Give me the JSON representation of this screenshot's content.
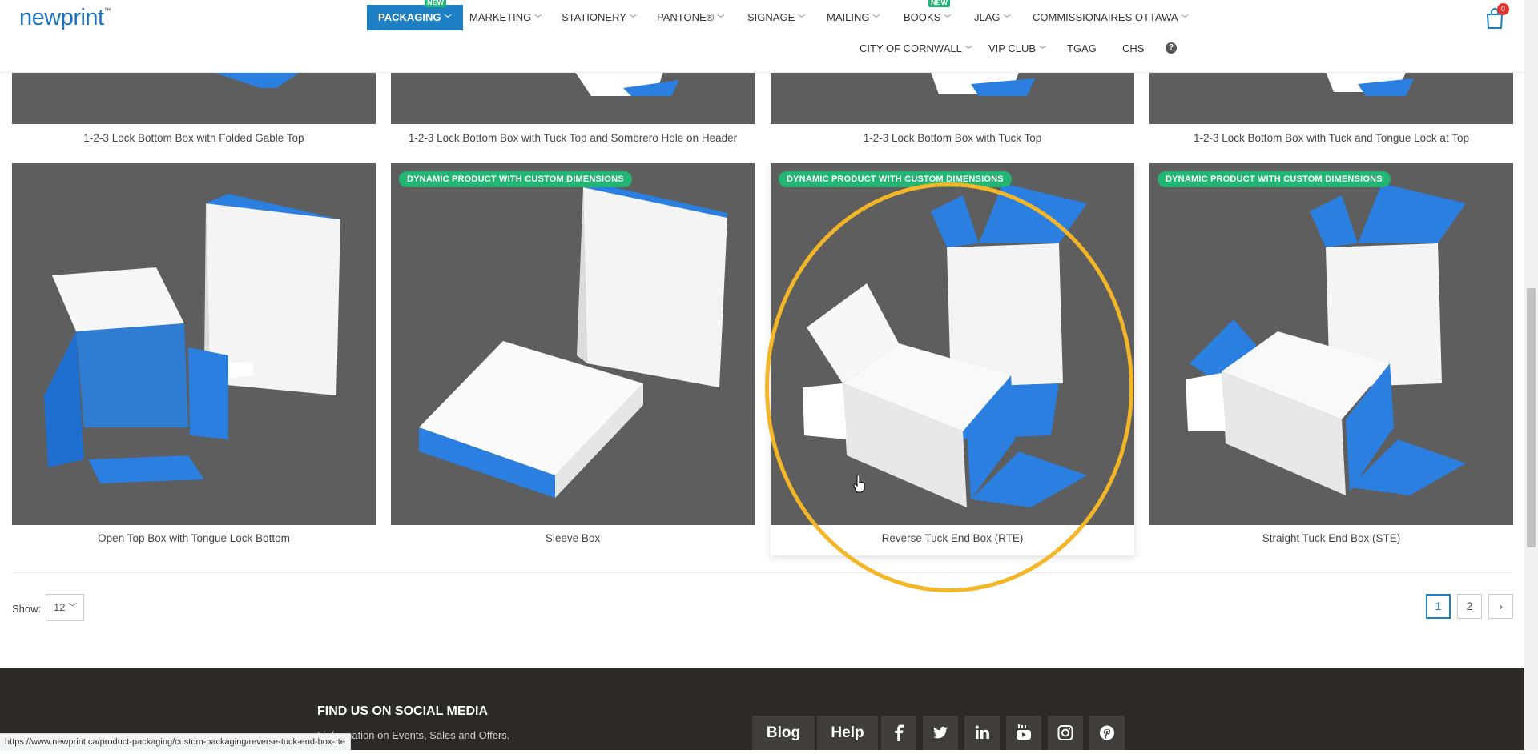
{
  "header": {
    "logo_text": "newprint",
    "logo_tm": "™",
    "nav_row1": [
      {
        "label": "PACKAGING",
        "badge": "NEW"
      },
      {
        "label": "MARKETING"
      },
      {
        "label": "STATIONERY"
      },
      {
        "label": "PANTONE®"
      },
      {
        "label": "SIGNAGE"
      },
      {
        "label": "MAILING"
      },
      {
        "label": "BOOKS",
        "badge": "NEW"
      },
      {
        "label": "JLAG"
      },
      {
        "label": "COMMISSIONAIRES OTTAWA"
      }
    ],
    "nav_row2": [
      {
        "label": "CITY OF CORNWALL"
      },
      {
        "label": "VIP CLUB"
      },
      {
        "label": "TGAG"
      },
      {
        "label": "CHS"
      }
    ],
    "help_symbol": "?",
    "cart_count": "0",
    "accent_color": "#1f7fc4",
    "badge_color": "#22b573"
  },
  "products_top_row": [
    {
      "title": "1-2-3 Lock Bottom Box with Folded Gable Top"
    },
    {
      "title": "1-2-3 Lock Bottom Box with Tuck Top and Sombrero Hole on Header"
    },
    {
      "title": "1-2-3 Lock Bottom Box with Tuck Top"
    },
    {
      "title": "1-2-3 Lock Bottom Box with Tuck and Tongue Lock at Top"
    }
  ],
  "products_row": [
    {
      "title": "Open Top Box with Tongue Lock Bottom",
      "badge": ""
    },
    {
      "title": "Sleeve Box",
      "badge": "DYNAMIC PRODUCT WITH CUSTOM DIMENSIONS"
    },
    {
      "title": "Reverse Tuck End Box (RTE)",
      "badge": "DYNAMIC PRODUCT WITH CUSTOM DIMENSIONS"
    },
    {
      "title": "Straight Tuck End Box (STE)",
      "badge": "DYNAMIC PRODUCT WITH CUSTOM DIMENSIONS"
    }
  ],
  "listing": {
    "show_label": "Show:",
    "show_value": "12",
    "pages": [
      "1",
      "2"
    ],
    "current_page": "1",
    "next_symbol": "›"
  },
  "footer": {
    "social_title": "FIND US ON SOCIAL MEDIA",
    "social_desc": "t information on Events, Sales and Offers.",
    "blog_label": "Blog",
    "help_label": "Help",
    "social_icons": [
      "facebook-icon",
      "twitter-icon",
      "linkedin-icon",
      "youtube-icon",
      "instagram-icon",
      "pinterest-icon"
    ]
  },
  "status_bar": {
    "url": "https://www.newprint.ca/product-packaging/custom-packaging/reverse-tuck-end-box-rte"
  }
}
